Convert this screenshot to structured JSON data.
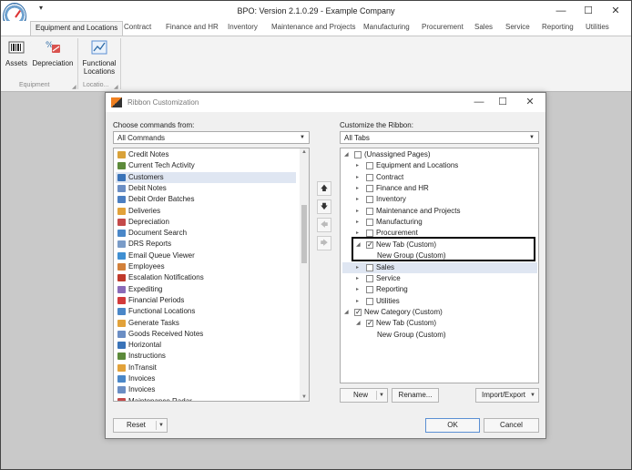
{
  "app": {
    "title": "BPO: Version 2.1.0.29 - Example Company",
    "quick_access": "▾",
    "minimize": "—",
    "maximize": "☐",
    "close": "✕"
  },
  "tabs": [
    "Equipment and Locations",
    "Contract",
    "Finance and HR",
    "Inventory",
    "Maintenance and Projects",
    "Manufacturing",
    "Procurement",
    "Sales",
    "Service",
    "Reporting",
    "Utilities"
  ],
  "ribbon": {
    "assets": "Assets",
    "depreciation": "Depreciation",
    "functional_locations_1": "Functional",
    "functional_locations_2": "Locations",
    "group_equipment": "Equipment",
    "group_locations": "Locatio..."
  },
  "dialog": {
    "title": "Ribbon Customization",
    "minimize": "—",
    "maximize": "☐",
    "close": "✕",
    "left_label": "Choose commands from:",
    "left_combo": "All Commands",
    "right_label": "Customize the Ribbon:",
    "right_combo": "All Tabs",
    "commands": [
      {
        "label": "Credit Notes",
        "color": "#d9a23a"
      },
      {
        "label": "Current Tech Activity",
        "color": "#5c8a3a"
      },
      {
        "label": "Customers",
        "color": "#3a73b8"
      },
      {
        "label": "Debit Notes",
        "color": "#6b8ec4"
      },
      {
        "label": "Debit Order Batches",
        "color": "#4b7fc2"
      },
      {
        "label": "Deliveries",
        "color": "#e2a23a"
      },
      {
        "label": "Depreciation",
        "color": "#c44a4a"
      },
      {
        "label": "Document Search",
        "color": "#4a87c8"
      },
      {
        "label": "DRS Reports",
        "color": "#7a9cc8"
      },
      {
        "label": "Email Queue Viewer",
        "color": "#3f8fd2"
      },
      {
        "label": "Employees",
        "color": "#d2803a"
      },
      {
        "label": "Escalation Notifications",
        "color": "#c0392b"
      },
      {
        "label": "Expediting",
        "color": "#8a6bb8"
      },
      {
        "label": "Financial Periods",
        "color": "#d23a3a"
      },
      {
        "label": "Functional Locations",
        "color": "#4a87c8"
      },
      {
        "label": "Generate Tasks",
        "color": "#e2a23a"
      },
      {
        "label": "Goods Received Notes",
        "color": "#6b8ec4"
      },
      {
        "label": "Horizontal",
        "color": "#3a73b8"
      },
      {
        "label": "Instructions",
        "color": "#5c8a3a"
      },
      {
        "label": "InTransit",
        "color": "#e2a23a"
      },
      {
        "label": "Invoices",
        "color": "#4a87c8"
      },
      {
        "label": "Invoices",
        "color": "#6b8ec4"
      },
      {
        "label": "Maintenance Radar",
        "color": "#c44a4a"
      }
    ],
    "move_up": "🡅",
    "move_down": "🡇",
    "move_left": "🡄",
    "move_right": "🡆",
    "tree": [
      {
        "label": "(Unassigned Pages)",
        "exp": "◢",
        "checked": false
      },
      {
        "label": "Equipment and Locations",
        "exp": "▸",
        "checked": false
      },
      {
        "label": "Contract",
        "exp": "▸",
        "checked": false
      },
      {
        "label": "Finance and HR",
        "exp": "▸",
        "checked": false
      },
      {
        "label": "Inventory",
        "exp": "▸",
        "checked": false
      },
      {
        "label": "Maintenance and Projects",
        "exp": "▸",
        "checked": false
      },
      {
        "label": "Manufacturing",
        "exp": "▸",
        "checked": false
      },
      {
        "label": "Procurement",
        "exp": "▸",
        "checked": false
      },
      {
        "label": "New Tab (Custom)",
        "exp": "◢",
        "checked": true
      },
      {
        "label": "New Group (Custom)",
        "exp": "",
        "checked": null
      },
      {
        "label": "Sales",
        "exp": "▸",
        "checked": false
      },
      {
        "label": "Service",
        "exp": "▸",
        "checked": false
      },
      {
        "label": "Reporting",
        "exp": "▸",
        "checked": false
      },
      {
        "label": "Utilities",
        "exp": "▸",
        "checked": false
      },
      {
        "label": "New Category (Custom)",
        "exp": "◢",
        "checked": true
      },
      {
        "label": "New Tab (Custom)",
        "exp": "◢",
        "checked": true
      },
      {
        "label": "New Group (Custom)",
        "exp": "",
        "checked": null
      }
    ],
    "new_button": "New",
    "rename_button": "Rename...",
    "import_export_button": "Import/Export",
    "reset_button": "Reset",
    "ok_button": "OK",
    "cancel_button": "Cancel"
  }
}
